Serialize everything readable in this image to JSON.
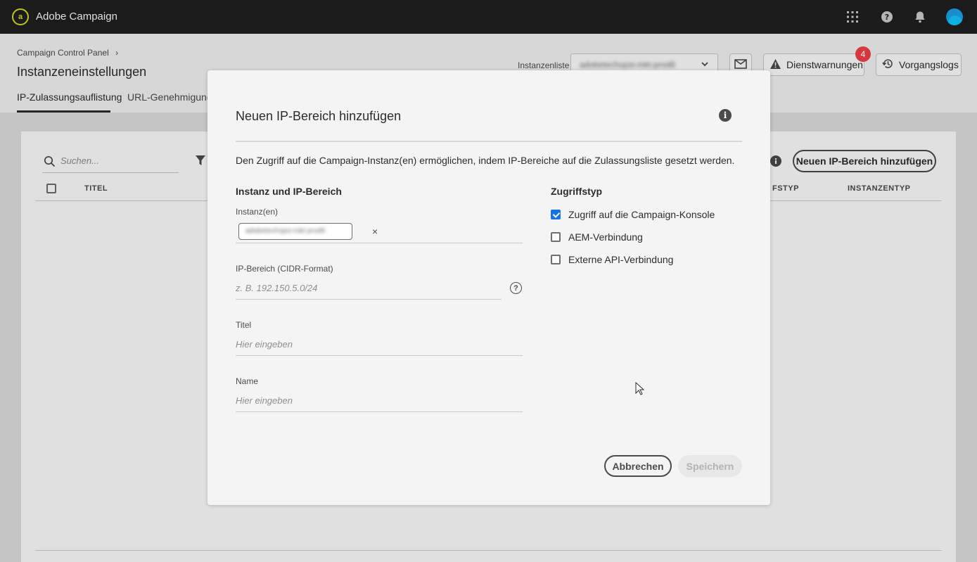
{
  "app": {
    "title": "Adobe Campaign"
  },
  "header": {
    "breadcrumb": "Campaign Control Panel",
    "page_title": "Instanzeneinstellungen",
    "tabs": [
      {
        "label": "IP-Zulassungsauflistung",
        "active": true
      },
      {
        "label": "URL-Genehmigungen",
        "active": false
      }
    ],
    "instance_list_label": "Instanzenliste",
    "instance_list_value": "adobetechopsi-mkt-prod6",
    "service_warnings_label": "Dienstwarnungen",
    "service_warnings_count": "4",
    "job_logs_label": "Vorgangslogs"
  },
  "list": {
    "search_placeholder": "Suchen...",
    "add_button_label": "Neuen IP-Bereich hinzufügen",
    "columns": [
      "TITEL",
      "FSTYP",
      "INSTANZENTYP"
    ]
  },
  "modal": {
    "title": "Neuen IP-Bereich hinzufügen",
    "description": "Den Zugriff auf die Campaign-Instanz(en) ermöglichen, indem IP-Bereiche auf die Zulassungsliste gesetzt werden.",
    "section_left": "Instanz und IP-Bereich",
    "section_right": "Zugriffstyp",
    "instances_label": "Instanz(en)",
    "instance_tag": "adobetechopsi-mkt-prod6",
    "ip_range_label": "IP-Bereich (CIDR-Format)",
    "ip_range_placeholder": "z. B. 192.150.5.0/24",
    "title_label": "Titel",
    "title_placeholder": "Hier eingeben",
    "name_label": "Name",
    "name_placeholder": "Hier eingeben",
    "access_types": [
      {
        "label": "Zugriff auf die Campaign-Konsole",
        "checked": true
      },
      {
        "label": "AEM-Verbindung",
        "checked": false
      },
      {
        "label": "Externe API-Verbindung",
        "checked": false
      }
    ],
    "cancel_label": "Abbrechen",
    "save_label": "Speichern"
  },
  "colors": {
    "accent": "#1473e6",
    "badge": "#d7373f",
    "topbar": "#1f1f1f"
  }
}
